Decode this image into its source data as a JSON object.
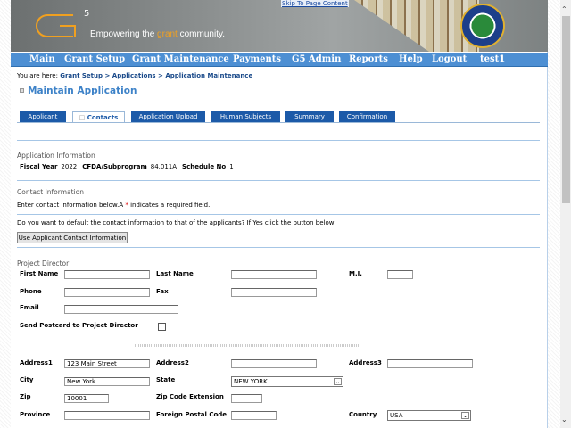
{
  "header": {
    "logo_mark": "G5",
    "tagline_pre": "Empowering the ",
    "tagline_accent": "grant",
    "tagline_post": " community.",
    "skip_link": "Skip To Page Content",
    "seal": "Department of Education seal"
  },
  "nav": [
    "Main",
    "Grant Setup",
    "Grant Maintenance",
    "Payments",
    "G5 Admin",
    "Reports",
    "Help",
    "Logout",
    "test1"
  ],
  "breadcrumb": {
    "prefix": "You are here: ",
    "items": [
      "Grant Setup",
      "Applications",
      "Application Maintenance"
    ],
    "sep": " > "
  },
  "page_title": "Maintain Application",
  "tabs": [
    {
      "label": "Applicant"
    },
    {
      "label": "Contacts",
      "active": true
    },
    {
      "label": "Application Upload"
    },
    {
      "label": "Human Subjects"
    },
    {
      "label": "Summary"
    },
    {
      "label": "Confirmation"
    }
  ],
  "app_info": {
    "heading": "Application Information",
    "fiscal_year_label": "Fiscal Year",
    "fiscal_year": "2022",
    "cfda_label": "CFDA/Subprogram",
    "cfda": "84.011A",
    "schedule_label": "Schedule No",
    "schedule": "1"
  },
  "contact": {
    "heading": "Contact Information",
    "instructions_pre": "Enter contact information below.A ",
    "required_mark": "*",
    "instructions_post": " indicates a required field.",
    "default_question": "Do you want to default the contact information to that of the applicants? If Yes click the button below",
    "use_button": "Use Applicant Contact Information"
  },
  "director": {
    "heading": "Project Director",
    "labels": {
      "first_name": "First Name",
      "last_name": "Last Name",
      "mi": "M.I.",
      "phone": "Phone",
      "fax": "Fax",
      "email": "Email",
      "postcard": "Send Postcard to Project Director",
      "address1": "Address1",
      "address2": "Address2",
      "address3": "Address3",
      "city": "City",
      "state": "State",
      "zip": "Zip",
      "zip_ext": "Zip Code Extension",
      "province": "Province",
      "foreign_postal": "Foreign Postal Code",
      "country": "Country"
    },
    "values": {
      "first_name": "",
      "last_name": "",
      "mi": "",
      "phone": "",
      "fax": "",
      "email": "",
      "postcard": false,
      "address1": "123 Main Street",
      "address2": "",
      "address3": "",
      "city": "New York",
      "state": "NEW YORK",
      "zip": "10001",
      "zip_ext": "",
      "province": "",
      "foreign_postal": "",
      "country": "USA"
    }
  },
  "colors": {
    "nav": "#4d8fd3",
    "tab": "#1c5aa8",
    "title": "#3d82c8",
    "accent": "#f0a020"
  }
}
